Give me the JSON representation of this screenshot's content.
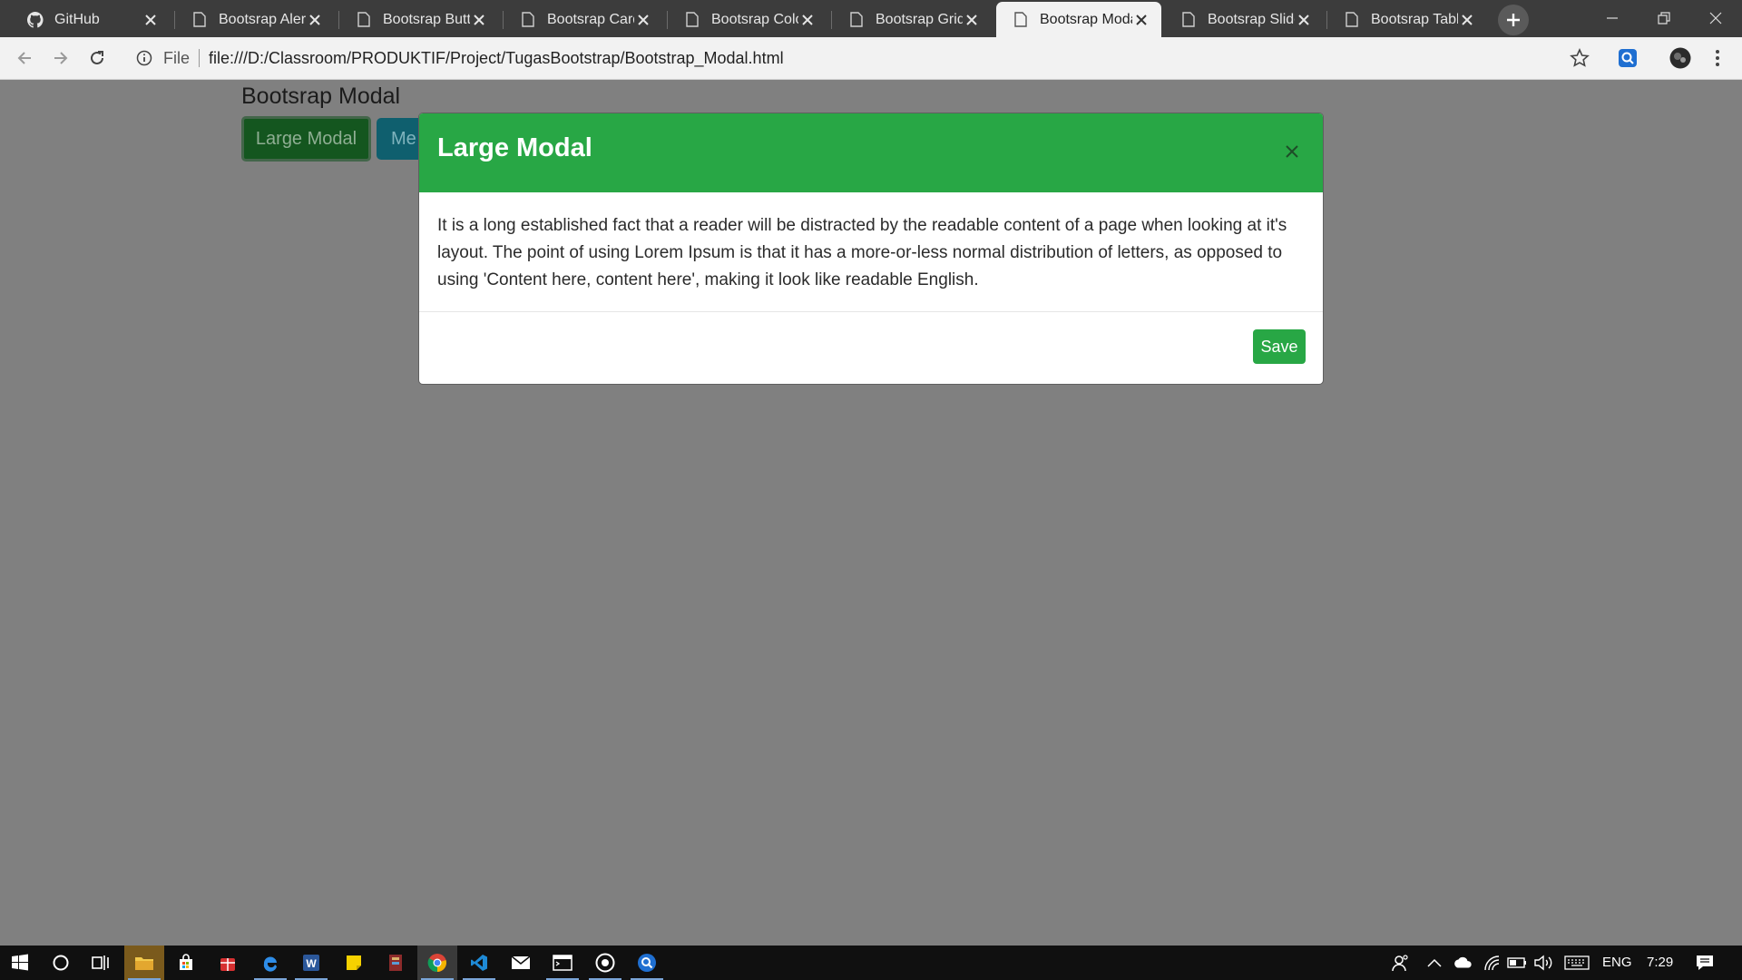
{
  "browser": {
    "tabs": [
      {
        "title": "GitHub",
        "icon": "github-icon"
      },
      {
        "title": "Bootsrap Alerts",
        "icon": "document-icon"
      },
      {
        "title": "Bootsrap Butto",
        "icon": "document-icon"
      },
      {
        "title": "Bootsrap Card",
        "icon": "document-icon"
      },
      {
        "title": "Bootsrap Color",
        "icon": "document-icon"
      },
      {
        "title": "Bootsrap Grid",
        "icon": "document-icon"
      },
      {
        "title": "Bootsrap Moda",
        "icon": "document-icon",
        "active": true
      },
      {
        "title": "Bootsrap Slide",
        "icon": "document-icon"
      },
      {
        "title": "Bootsrap Table",
        "icon": "document-icon"
      }
    ],
    "address": {
      "scheme_label": "File",
      "url": "file:///D:/Classroom/PRODUKTIF/Project/TugasBootstrap/Bootstrap_Modal.html"
    }
  },
  "page": {
    "heading": "Bootsrap Modal",
    "buttons": {
      "large_label": "Large Modal",
      "medium_label": "Me"
    }
  },
  "modal": {
    "title": "Large Modal",
    "body": "It is a long established fact that a reader will be distracted by the readable content of a page when looking at it's layout. The point of using Lorem Ipsum is that it has a more-or-less normal distribution of letters, as opposed to using 'Content here, content here', making it look like readable English.",
    "save_label": "Save"
  },
  "taskbar": {
    "language": "ENG",
    "time": "7:29"
  },
  "colors": {
    "success": "#28a745",
    "overlay": "#808080",
    "taskbar": "#101010"
  }
}
